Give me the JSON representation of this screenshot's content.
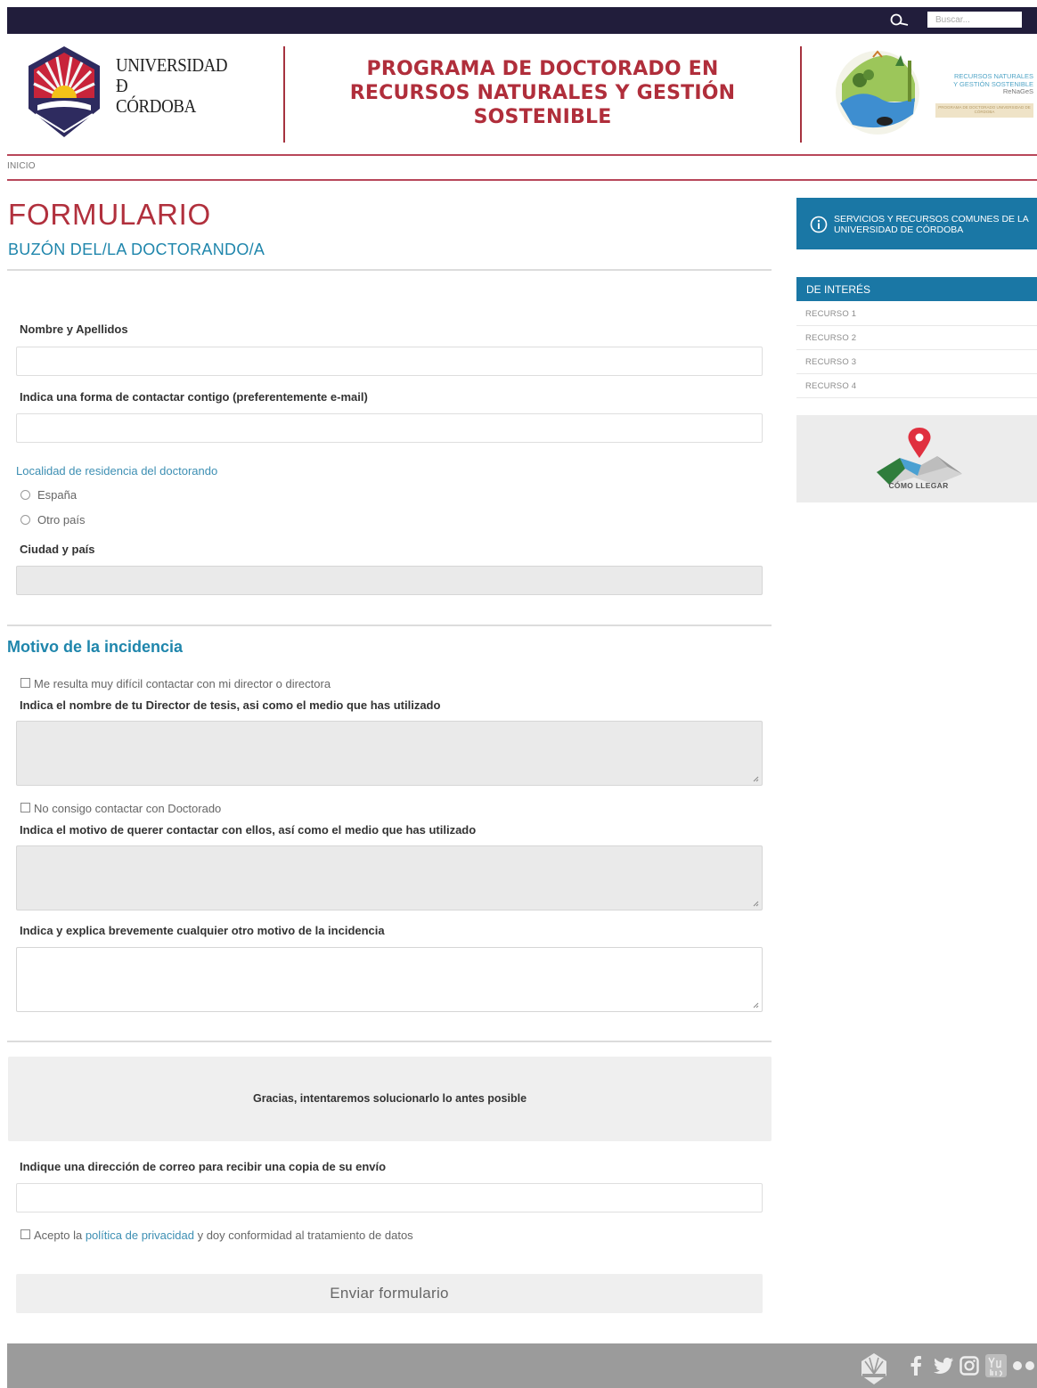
{
  "topbar": {
    "search_placeholder": "Buscar..."
  },
  "header": {
    "university_lines": [
      "UNIVERSIDAD",
      "Đ",
      "CÓRDOBA"
    ],
    "program_title_lines": [
      "PROGRAMA DE DOCTORADO EN",
      "RECURSOS NATURALES Y GESTIÓN",
      "SOSTENIBLE"
    ],
    "program_logo_text": {
      "line1": "RECURSOS NATURALES",
      "line2": "Y GESTIÓN SOSTENIBLE",
      "line3": "ReNaGeS",
      "band": "PROGRAMA DE DOCTORADO UNIVERSIDAD DE CÓRDOBA"
    }
  },
  "breadcrumb": "INICIO",
  "main": {
    "title": "FORMULARIO",
    "subtitle": "BUZÓN DEL/LA DOCTORANDO/A"
  },
  "form": {
    "name_label": "Nombre y Apellidos",
    "contact_label": "Indica una forma de contactar contigo (preferentemente e-mail)",
    "residence_label": "Localidad de residencia del doctorando",
    "residence_options": [
      "España",
      "Otro país"
    ],
    "city_label": "Ciudad y país",
    "section_title": "Motivo de la incidencia",
    "check_director": "Me resulta muy difícil contactar con mi director o directora",
    "director_label": "Indica el nombre de tu Director de tesis, asi como el medio que has utilizado",
    "check_doctorado": "No consigo contactar con Doctorado",
    "doctorado_label": "Indica el motivo de querer contactar con ellos, así como el medio que has utilizado",
    "other_label": "Indica y explica brevemente cualquier otro motivo de la incidencia",
    "thanks": "Gracias, intentaremos solucionarlo lo antes posible",
    "copy_email_label": "Indique una dirección de correo para recibir una copia de su envío",
    "privacy_prefix": "Acepto la",
    "privacy_link": "política de privacidad",
    "privacy_suffix": "y doy conformidad al tratamiento de datos",
    "submit": "Enviar formulario"
  },
  "sidebar": {
    "services": "SERVICIOS Y RECURSOS COMUNES DE LA UNIVERSIDAD DE CÓRDOBA",
    "interest_header": "DE INTERÉS",
    "resources": [
      "RECURSO 1",
      "RECURSO 2",
      "RECURSO 3",
      "RECURSO 4"
    ],
    "map_label": "CÓMO LLEGAR"
  },
  "footer": {
    "icons": [
      "uco-logo-icon",
      "facebook-icon",
      "twitter-icon",
      "instagram-icon",
      "youtube-icon",
      "flickr-icon"
    ]
  },
  "colors": {
    "topbar": "#211d3b",
    "brand_red": "#b02e3b",
    "accent_blue": "#1a77a5",
    "footer": "#9b9b9b"
  }
}
